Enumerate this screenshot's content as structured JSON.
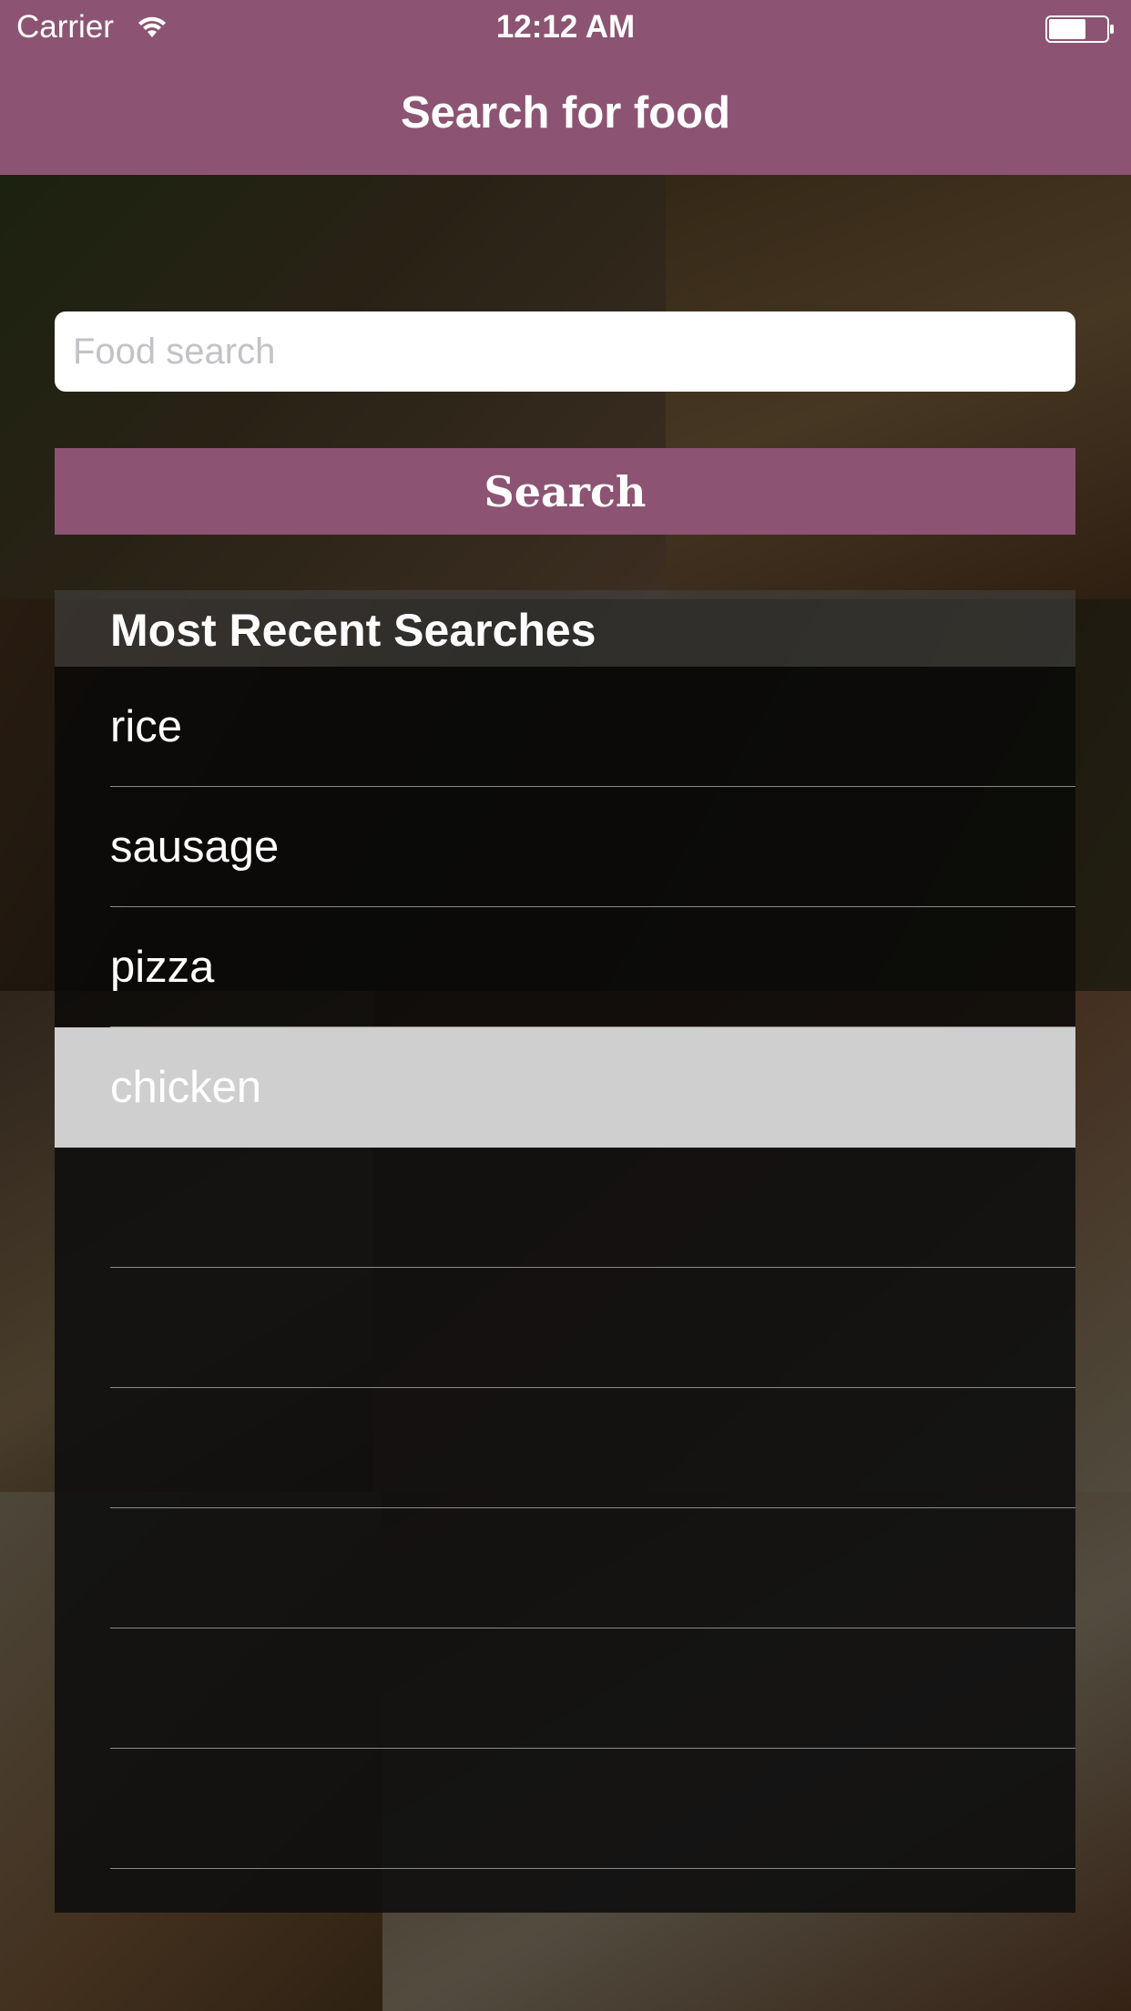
{
  "status_bar": {
    "carrier": "Carrier",
    "time": "12:12 AM"
  },
  "nav": {
    "title": "Search for food"
  },
  "search": {
    "placeholder": "Food search",
    "value": "",
    "button_label": "Search"
  },
  "recent": {
    "header": "Most Recent Searches",
    "items": [
      {
        "label": "rice"
      },
      {
        "label": "sausage"
      },
      {
        "label": "pizza"
      },
      {
        "label": "chicken"
      }
    ]
  },
  "colors": {
    "brand": "#8c5472",
    "selected_row": "#cfcfcf"
  },
  "icons": [
    "wifi-icon",
    "battery-icon"
  ]
}
